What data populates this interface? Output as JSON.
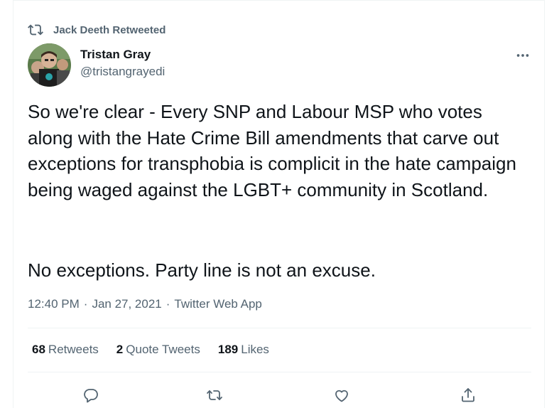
{
  "social_context": {
    "text": "Jack Deeth Retweeted",
    "icon": "retweet-icon"
  },
  "author": {
    "name": "Tristan Gray",
    "handle": "@tristangrayedi",
    "avatar": "avatar-photo"
  },
  "tweet": {
    "paragraph_1": "So we're clear - Every SNP and Labour MSP who votes along with the Hate Crime Bill amendments that carve out exceptions for transphobia is complicit in the hate campaign being waged against the LGBT+ community in Scotland.",
    "paragraph_2": "No exceptions. Party line is not an excuse."
  },
  "meta": {
    "time": "12:40 PM",
    "date": "Jan 27, 2021",
    "separator": "·",
    "source": "Twitter Web App"
  },
  "stats": {
    "retweets_count": "68",
    "retweets_label": "Retweets",
    "quotes_count": "2",
    "quotes_label": "Quote Tweets",
    "likes_count": "189",
    "likes_label": "Likes"
  },
  "actions": {
    "reply": "reply-icon",
    "retweet": "retweet-icon",
    "like": "heart-icon",
    "share": "share-icon"
  },
  "colors": {
    "text_primary": "#0f1419",
    "text_secondary": "#536471",
    "divider": "#eff3f4"
  }
}
